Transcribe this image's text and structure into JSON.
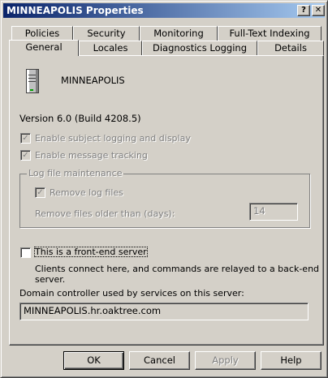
{
  "window": {
    "title": "MINNEAPOLIS Properties",
    "help_glyph": "?",
    "close_glyph": "✕"
  },
  "tabs": {
    "row_back": [
      "Policies",
      "Security",
      "Monitoring",
      "Full-Text Indexing"
    ],
    "row_front": [
      "General",
      "Locales",
      "Diagnostics Logging",
      "Details"
    ],
    "active": "General"
  },
  "general": {
    "server_name": "MINNEAPOLIS",
    "version": "Version 6.0 (Build 4208.5)",
    "enable_subject_logging": {
      "label": "Enable subject logging and display",
      "checked": true,
      "enabled": false
    },
    "enable_message_tracking": {
      "label": "Enable message tracking",
      "checked": true,
      "enabled": false
    },
    "log_file_group_label": "Log file maintenance",
    "remove_log_files": {
      "label": "Remove log files",
      "checked": true,
      "enabled": false
    },
    "remove_older_than_label": "Remove files older than (days):",
    "remove_older_than_value": "14",
    "front_end": {
      "label": "This is a front-end server",
      "checked": false
    },
    "front_end_description": "Clients connect here, and commands are relayed to a back-end server.",
    "domain_controller_label": "Domain controller used by services on this server:",
    "domain_controller_value": "MINNEAPOLIS.hr.oaktree.com"
  },
  "buttons": {
    "ok": "OK",
    "cancel": "Cancel",
    "apply": "Apply",
    "help": "Help"
  },
  "check_glyph": "✓"
}
